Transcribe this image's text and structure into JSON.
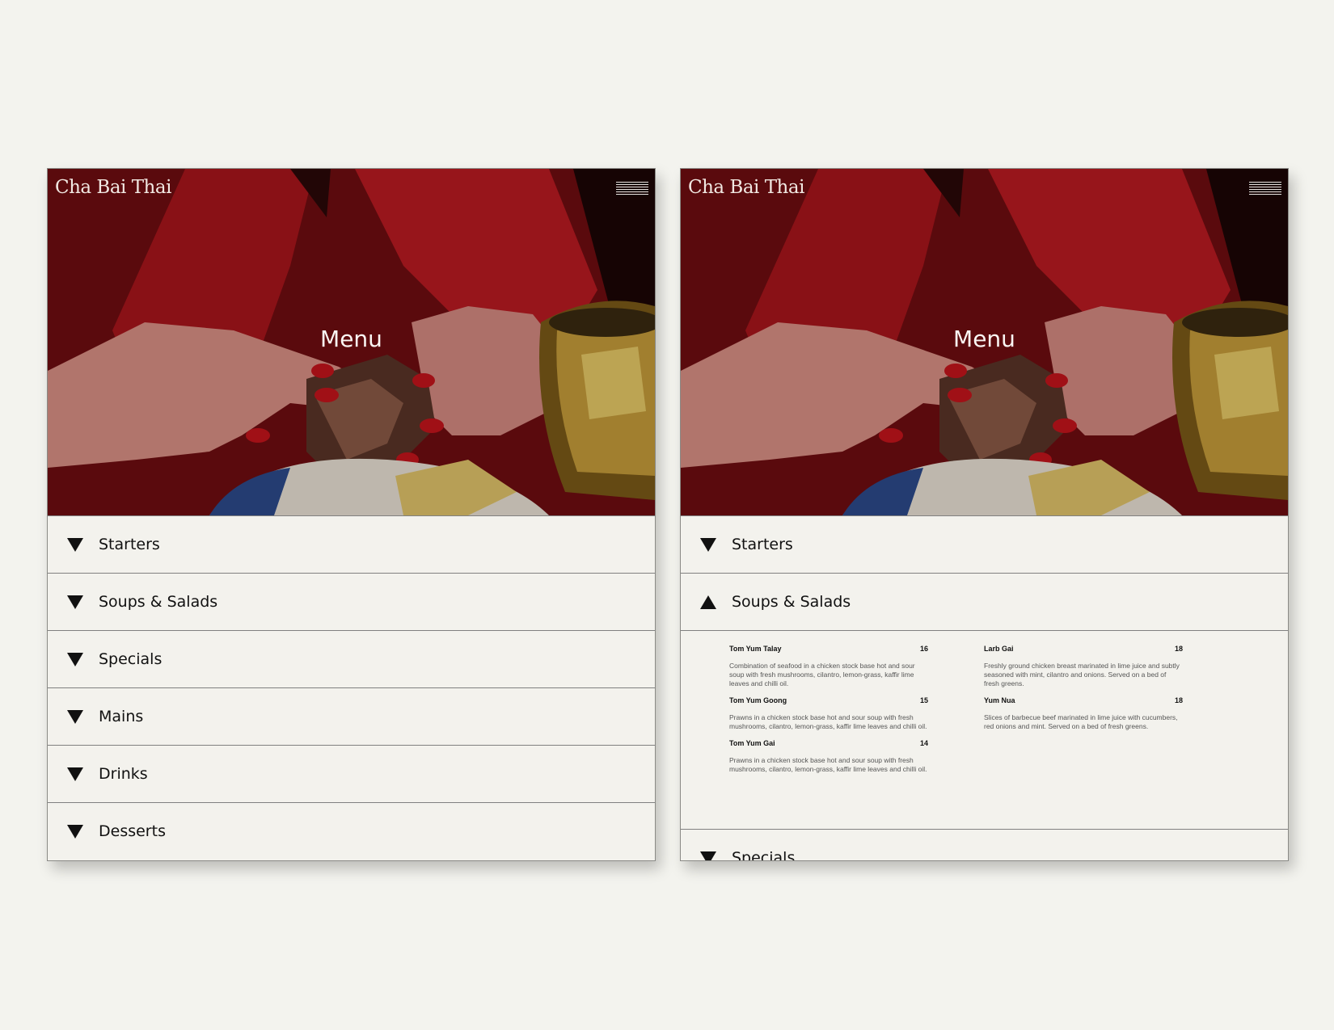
{
  "site": {
    "brand": "Cha Bai Thai",
    "menu_icon": "hamburger-icon",
    "hero_title": "Menu"
  },
  "colors": {
    "background": "#f3f3ee",
    "panel": "#f3f2ed",
    "hero_red": "#b3171e",
    "text": "#111111"
  },
  "left": {
    "sections": [
      {
        "label": "Starters",
        "icon": "chevron-down-triangle-icon"
      },
      {
        "label": "Soups & Salads",
        "icon": "chevron-down-triangle-icon"
      },
      {
        "label": "Specials",
        "icon": "chevron-down-triangle-icon"
      },
      {
        "label": "Mains",
        "icon": "chevron-down-triangle-icon"
      },
      {
        "label": "Drinks",
        "icon": "chevron-down-triangle-icon"
      },
      {
        "label": "Desserts",
        "icon": "chevron-down-triangle-icon"
      }
    ]
  },
  "right": {
    "sections": [
      {
        "label": "Starters",
        "expanded": false
      },
      {
        "label": "Soups & Salads",
        "expanded": true
      },
      {
        "label": "Specials",
        "expanded": false
      }
    ],
    "soups_items": {
      "col1": [
        {
          "name": "Tom Yum Talay",
          "price": "16",
          "desc": "Combination of seafood in a chicken stock base hot and sour soup with fresh mushrooms, cilantro, lemon-grass, kaffir lime leaves and chilli oil."
        },
        {
          "name": "Tom Yum Goong",
          "price": "15",
          "desc": "Prawns in a chicken stock base hot and sour soup with fresh mushrooms, cilantro, lemon-grass, kaffir lime leaves and chilli oil."
        },
        {
          "name": "Tom Yum Gai",
          "price": "14",
          "desc": "Prawns in a chicken stock base hot and sour soup with fresh mushrooms, cilantro, lemon-grass, kaffir lime leaves and chilli oil."
        }
      ],
      "col2": [
        {
          "name": "Larb Gai",
          "price": "18",
          "desc": "Freshly ground chicken breast marinated in lime juice and subtly seasoned with mint, cilantro and onions. Served on a bed of fresh greens."
        },
        {
          "name": "Yum Nua",
          "price": "18",
          "desc": "Slices of barbecue beef marinated in lime juice with cucumbers, red onions and mint. Served on a bed of fresh greens."
        }
      ]
    }
  }
}
